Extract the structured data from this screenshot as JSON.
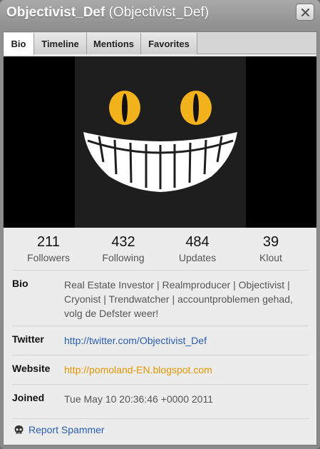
{
  "window": {
    "title_bold": "Objectivist_Def",
    "title_rest": "(Objectivist_Def)"
  },
  "tabs": [
    {
      "label": "Bio",
      "active": true
    },
    {
      "label": "Timeline",
      "active": false
    },
    {
      "label": "Mentions",
      "active": false
    },
    {
      "label": "Favorites",
      "active": false
    }
  ],
  "stats": [
    {
      "value": "211",
      "label": "Followers"
    },
    {
      "value": "432",
      "label": "Following"
    },
    {
      "value": "484",
      "label": "Updates"
    },
    {
      "value": "39",
      "label": "Klout"
    }
  ],
  "details": {
    "bio": {
      "key": "Bio",
      "value": "Real Estate Investor | Realmproducer | Objectivist | Cryonist | Trendwatcher | accountproblemen gehad, volg de Defster weer!"
    },
    "twitter": {
      "key": "Twitter",
      "value": "http://twitter.com/Objectivist_Def"
    },
    "website": {
      "key": "Website",
      "value": "http://pomoland-EN.blogspot.com"
    },
    "joined": {
      "key": "Joined",
      "value": "Tue May 10 20:36:46 +0000 2011"
    }
  },
  "report": {
    "label": "Report Spammer",
    "icon": "skull-icon"
  },
  "colors": {
    "link": "#2a5db0",
    "website": "#e69500",
    "eye": "#f2b21c"
  }
}
